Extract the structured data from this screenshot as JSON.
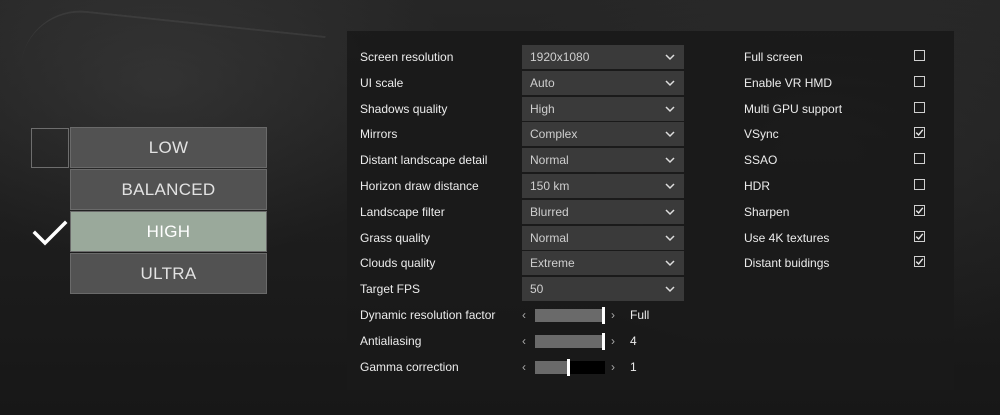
{
  "presets": {
    "items": [
      {
        "label": "LOW",
        "active": false
      },
      {
        "label": "BALANCED",
        "active": false
      },
      {
        "label": "HIGH",
        "active": true
      },
      {
        "label": "ULTRA",
        "active": false
      }
    ],
    "selected": "HIGH"
  },
  "dropdowns": [
    {
      "label": "Screen resolution",
      "value": "1920x1080"
    },
    {
      "label": "UI scale",
      "value": "Auto"
    },
    {
      "label": "Shadows quality",
      "value": "High"
    },
    {
      "label": "Mirrors",
      "value": "Complex"
    },
    {
      "label": "Distant landscape detail",
      "value": "Normal"
    },
    {
      "label": "Horizon draw distance",
      "value": "150 km"
    },
    {
      "label": "Landscape filter",
      "value": "Blurred"
    },
    {
      "label": "Grass quality",
      "value": "Normal"
    },
    {
      "label": "Clouds quality",
      "value": "Extreme"
    },
    {
      "label": "Target FPS",
      "value": "50"
    }
  ],
  "sliders": [
    {
      "label": "Dynamic resolution factor",
      "value": "Full",
      "level_percent": 100
    },
    {
      "label": "Antialiasing",
      "value": "4",
      "level_percent": 100
    },
    {
      "label": "Gamma correction",
      "value": "1",
      "level_percent": 50
    }
  ],
  "checkboxes": [
    {
      "label": "Full screen",
      "checked": false
    },
    {
      "label": "Enable VR HMD",
      "checked": false
    },
    {
      "label": "Multi GPU support",
      "checked": false
    },
    {
      "label": "VSync",
      "checked": true
    },
    {
      "label": "SSAO",
      "checked": false
    },
    {
      "label": "HDR",
      "checked": false
    },
    {
      "label": "Sharpen",
      "checked": true
    },
    {
      "label": "Use 4K textures",
      "checked": true
    },
    {
      "label": "Distant buidings",
      "checked": true
    }
  ],
  "colors": {
    "preset_button": "#525252",
    "preset_active": "#9aa99b",
    "panel_bg": "#1a1a1a",
    "select_bg": "#3a3a3a"
  },
  "icons": {
    "selected_preset": "checkmark-icon",
    "dropdown": "chevron-down-icon",
    "slider_decrease": "chevron-left-icon",
    "slider_increase": "chevron-right-icon",
    "checkbox_checked": "checkmark-icon"
  }
}
